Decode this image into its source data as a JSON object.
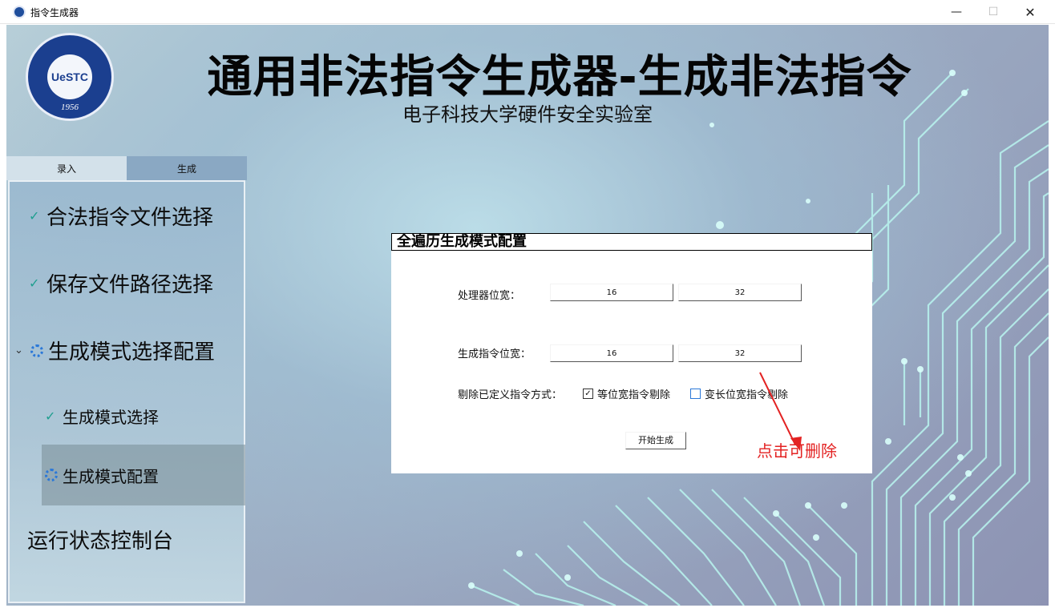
{
  "window": {
    "title": "指令生成器",
    "minimize": "—",
    "maximize": "☐",
    "close": "✕"
  },
  "header": {
    "logo_text": "UeSTC",
    "logo_year": "1956",
    "title": "通用非法指令生成器-生成非法指令",
    "subtitle": "电子科技大学硬件安全实验室"
  },
  "tabs": [
    "录入",
    "生成"
  ],
  "sidebar": {
    "items": [
      {
        "label": "合法指令文件选择",
        "status": "done"
      },
      {
        "label": "保存文件路径选择",
        "status": "done"
      },
      {
        "label": "生成模式选择配置",
        "status": "in-progress",
        "expanded": true
      },
      {
        "label": "生成模式选择",
        "status": "done"
      },
      {
        "label": "生成模式配置",
        "status": "in-progress",
        "selected": true
      },
      {
        "label": "运行状态控制台",
        "status": "none"
      }
    ]
  },
  "dialog": {
    "title": "全遍历生成模式配置",
    "processor_width_label": "处理器位宽：",
    "processor_width_options": [
      "16",
      "32"
    ],
    "instr_width_label": "生成指令位宽：",
    "instr_width_options": [
      "16",
      "32"
    ],
    "remove_label": "剔除已定义指令方式：",
    "remove_options": [
      {
        "label": "等位宽指令剔除",
        "checked": true
      },
      {
        "label": "变长位宽指令剔除",
        "checked": false
      }
    ],
    "start_button": "开始生成"
  },
  "annotation": {
    "text": "点击可删除",
    "color": "#e32222"
  },
  "colors": {
    "tab_active": "#d3e1ea",
    "tab_inactive": "#8aa8c3",
    "check": "#1f9f8f",
    "spinner": "#2b78d8",
    "circuit": "#b9f5ef"
  }
}
